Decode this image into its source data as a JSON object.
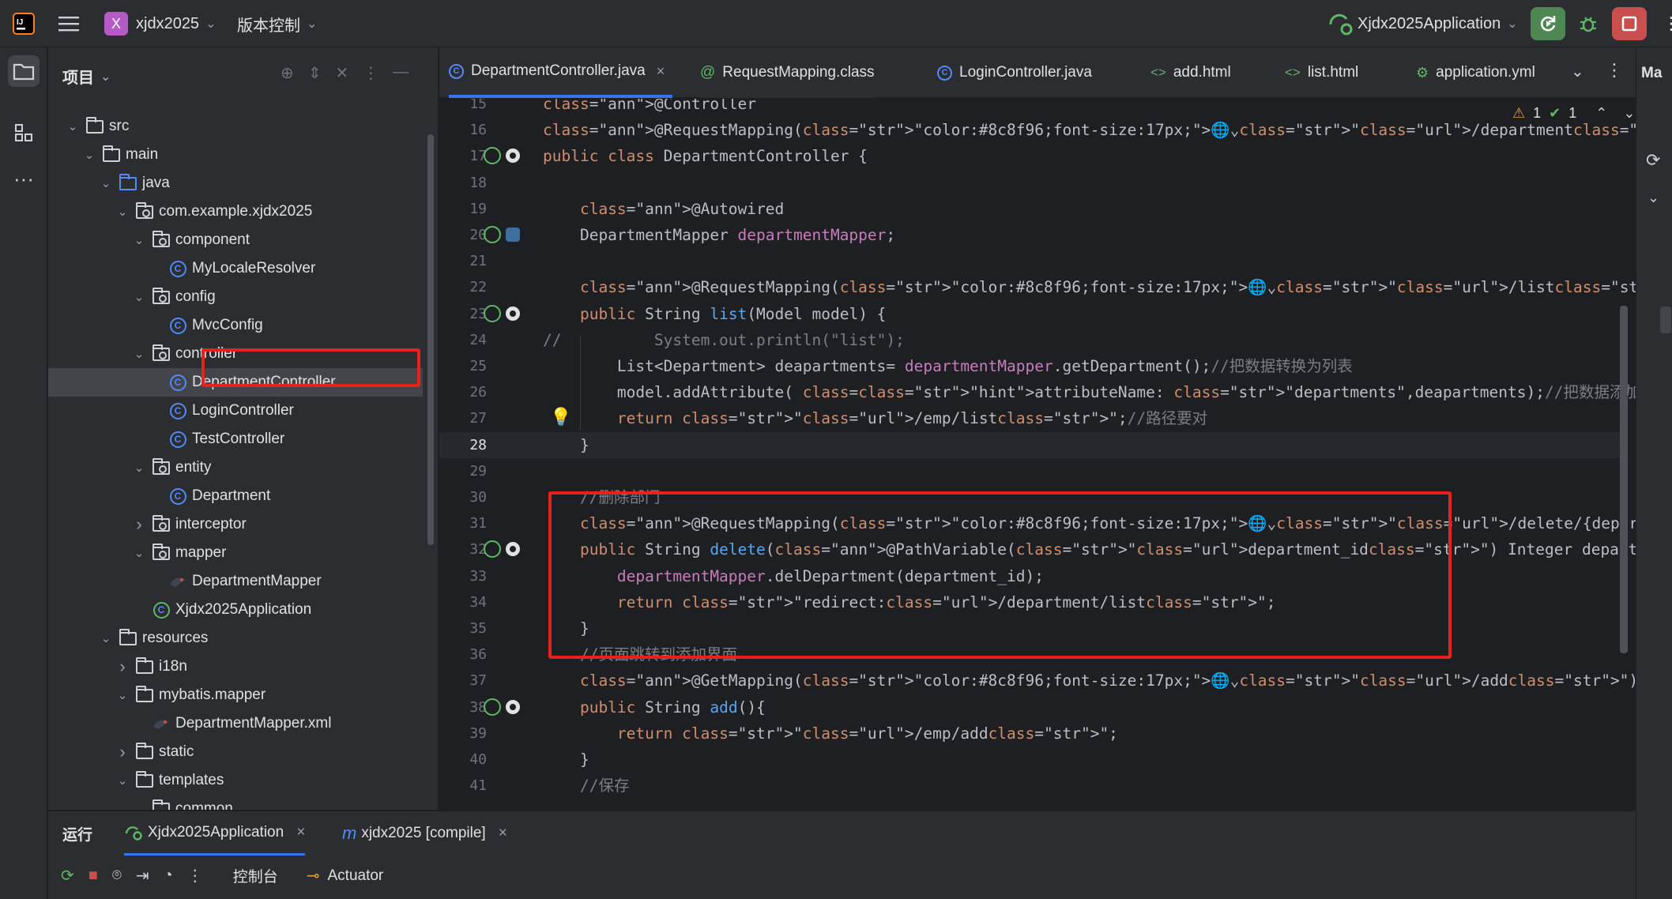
{
  "titlebar": {
    "project_badge": "X",
    "project_name": "xjdx2025",
    "vcs_label": "版本控制",
    "run_config": "Xjdx2025Application"
  },
  "project_panel": {
    "title": "项目",
    "tree": [
      {
        "label": "src",
        "icon": "folder-icon",
        "indent": 1,
        "expanded": true
      },
      {
        "label": "main",
        "icon": "folder-icon",
        "indent": 2,
        "expanded": true
      },
      {
        "label": "java",
        "icon": "source-folder-icon",
        "indent": 3,
        "expanded": true
      },
      {
        "label": "com.example.xjdx2025",
        "icon": "package-icon",
        "indent": 4,
        "expanded": true
      },
      {
        "label": "component",
        "icon": "package-icon",
        "indent": 5,
        "expanded": true
      },
      {
        "label": "MyLocaleResolver",
        "icon": "class-icon",
        "indent": 6
      },
      {
        "label": "config",
        "icon": "package-icon",
        "indent": 5,
        "expanded": true
      },
      {
        "label": "MvcConfig",
        "icon": "class-icon",
        "indent": 6
      },
      {
        "label": "controller",
        "icon": "package-icon",
        "indent": 5,
        "expanded": true
      },
      {
        "label": "DepartmentController",
        "icon": "class-icon",
        "indent": 6,
        "selected": true
      },
      {
        "label": "LoginController",
        "icon": "class-icon",
        "indent": 6
      },
      {
        "label": "TestController",
        "icon": "class-icon",
        "indent": 6
      },
      {
        "label": "entity",
        "icon": "package-icon",
        "indent": 5,
        "expanded": true
      },
      {
        "label": "Department",
        "icon": "class-icon",
        "indent": 6
      },
      {
        "label": "interceptor",
        "icon": "package-icon",
        "indent": 5,
        "expanded": false
      },
      {
        "label": "mapper",
        "icon": "package-icon",
        "indent": 5,
        "expanded": true
      },
      {
        "label": "DepartmentMapper",
        "icon": "mybatis-icon",
        "indent": 6
      },
      {
        "label": "Xjdx2025Application",
        "icon": "spring-class-icon",
        "indent": 5
      },
      {
        "label": "resources",
        "icon": "resources-folder-icon",
        "indent": 3,
        "expanded": true
      },
      {
        "label": "i18n",
        "icon": "folder-icon",
        "indent": 4,
        "expanded": false
      },
      {
        "label": "mybatis.mapper",
        "icon": "folder-icon",
        "indent": 4,
        "expanded": true
      },
      {
        "label": "DepartmentMapper.xml",
        "icon": "mybatis-xml-icon",
        "indent": 5
      },
      {
        "label": "static",
        "icon": "folder-icon",
        "indent": 4,
        "expanded": false
      },
      {
        "label": "templates",
        "icon": "folder-icon",
        "indent": 4,
        "expanded": true
      },
      {
        "label": "common",
        "icon": "folder-icon",
        "indent": 5,
        "expanded": true
      }
    ]
  },
  "editor": {
    "tabs": [
      {
        "label": "DepartmentController.java",
        "icon": "class-icon",
        "active": true,
        "closable": true
      },
      {
        "label": "RequestMapping.class",
        "icon": "annotation-icon"
      },
      {
        "label": "LoginController.java",
        "icon": "class-icon"
      },
      {
        "label": "add.html",
        "icon": "html-icon"
      },
      {
        "label": "list.html",
        "icon": "html-icon"
      },
      {
        "label": "application.yml",
        "icon": "spring-config-icon"
      }
    ],
    "inspections": {
      "warnings": "1",
      "ok": "1"
    },
    "current_line": "28",
    "lines": [
      {
        "n": "15",
        "code": "@Controller"
      },
      {
        "n": "16",
        "code": "@RequestMapping(🌐⌄\"/department\")"
      },
      {
        "n": "17",
        "code": "public class DepartmentController {"
      },
      {
        "n": "18",
        "code": ""
      },
      {
        "n": "19",
        "code": "    @Autowired"
      },
      {
        "n": "20",
        "code": "    DepartmentMapper departmentMapper;"
      },
      {
        "n": "21",
        "code": ""
      },
      {
        "n": "22",
        "code": "    @RequestMapping(🌐⌄\"/list\")"
      },
      {
        "n": "23",
        "code": "    public String list(Model model) {"
      },
      {
        "n": "24",
        "code": "//          System.out.println(\"list\");"
      },
      {
        "n": "25",
        "code": "        List<Department> deapartments= departmentMapper.getDepartment();//把数据转换为列表"
      },
      {
        "n": "26",
        "code": "        model.addAttribute( attributeName: \"departments\",deapartments);//把数据添加到模型中,可以使用模板语法对其进行传递和获取"
      },
      {
        "n": "27",
        "code": "        return \"/emp/list\";//路径要对"
      },
      {
        "n": "28",
        "code": "    }"
      },
      {
        "n": "29",
        "code": ""
      },
      {
        "n": "30",
        "code": "    //删除部门"
      },
      {
        "n": "31",
        "code": "    @RequestMapping(🌐⌄\"/delete/{department_id}\")"
      },
      {
        "n": "32",
        "code": "    public String delete(@PathVariable(\"department_id\") Integer department_id) {//从前端中的id"
      },
      {
        "n": "33",
        "code": "        departmentMapper.delDepartment(department_id);"
      },
      {
        "n": "34",
        "code": "        return \"redirect:/department/list\";"
      },
      {
        "n": "35",
        "code": "    }"
      },
      {
        "n": "36",
        "code": "    //页面跳转到添加界面"
      },
      {
        "n": "37",
        "code": "    @GetMapping(🌐⌄\"/add\")"
      },
      {
        "n": "38",
        "code": "    public String add(){"
      },
      {
        "n": "39",
        "code": "        return \"/emp/add\";"
      },
      {
        "n": "40",
        "code": "    }"
      },
      {
        "n": "41",
        "code": "    //保存"
      }
    ]
  },
  "right_strip": {
    "label": "Ma"
  },
  "bottom_panel": {
    "title": "运行",
    "tabs": [
      {
        "label": "Xjdx2025Application",
        "icon": "spring-run-icon"
      },
      {
        "label": "xjdx2025 [compile]",
        "icon": "maven-icon"
      }
    ],
    "toolbar": {
      "console_label": "控制台",
      "actuator_label": "Actuator"
    }
  },
  "colors": {
    "accent": "#3574f0",
    "highlight_box": "#e5221b",
    "run_green": "#4e8752",
    "stop_red": "#c94f4f"
  }
}
